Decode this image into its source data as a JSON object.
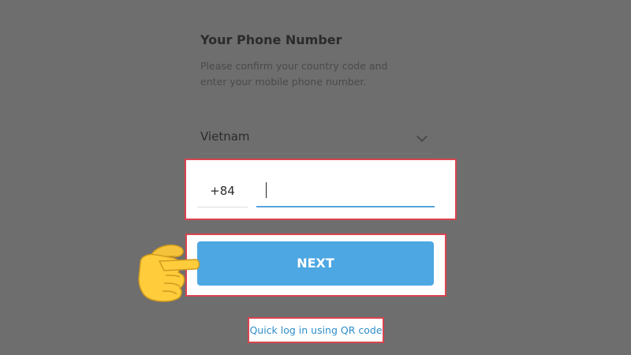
{
  "header": {
    "title": "Your Phone Number",
    "subtitle": "Please confirm your country code and enter your mobile phone number."
  },
  "country": {
    "name": "Vietnam",
    "icon": "chevron-down-icon"
  },
  "phone": {
    "country_code": "+84",
    "number": ""
  },
  "actions": {
    "next_label": "NEXT",
    "qr_login_label": "Quick log in using QR code"
  },
  "annotations": {
    "highlight_color": "#d94450",
    "pointer_icon": "pointing-hand-icon"
  },
  "colors": {
    "background": "#6e6e6e",
    "accent": "#4ca7e2",
    "link": "#2f8ec9"
  }
}
